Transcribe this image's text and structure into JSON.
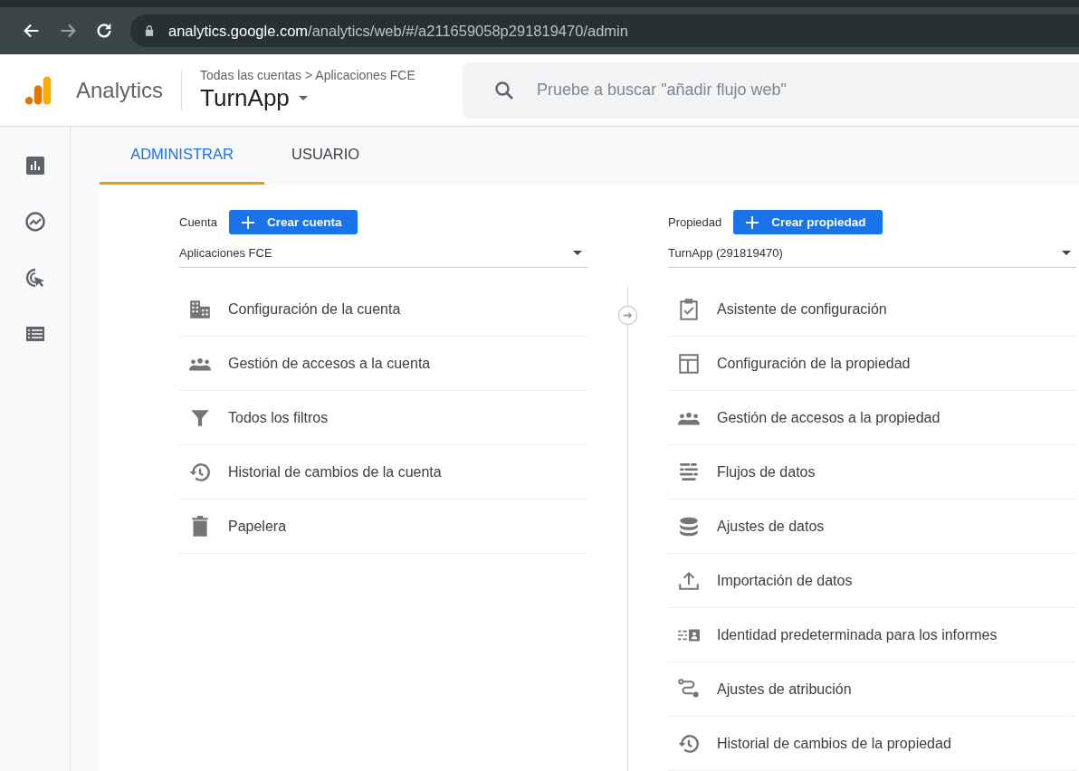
{
  "browser": {
    "url_host": "analytics.google.com",
    "url_path": "/analytics/web/#/a211659058p291819470/admin"
  },
  "header": {
    "product": "Analytics",
    "breadcrumb": "Todas las cuentas > Aplicaciones FCE",
    "property": "TurnApp",
    "search": {
      "placeholder": "Pruebe a buscar \"añadir flujo web\""
    }
  },
  "tabs": [
    {
      "label": "ADMINISTRAR",
      "selected": true
    },
    {
      "label": "USUARIO",
      "selected": false
    }
  ],
  "account": {
    "label": "Cuenta",
    "button": "Crear cuenta",
    "selector": "Aplicaciones FCE",
    "items": [
      {
        "label": "Configuración de la cuenta"
      },
      {
        "label": "Gestión de accesos a la cuenta"
      },
      {
        "label": "Todos los filtros"
      },
      {
        "label": "Historial de cambios de la cuenta"
      },
      {
        "label": "Papelera"
      }
    ]
  },
  "property": {
    "label": "Propiedad",
    "button": "Crear propiedad",
    "selector": "TurnApp (291819470)",
    "items": [
      {
        "label": "Asistente de configuración"
      },
      {
        "label": "Configuración de la propiedad"
      },
      {
        "label": "Gestión de accesos a la propiedad"
      },
      {
        "label": "Flujos de datos"
      },
      {
        "label": "Ajustes de datos"
      },
      {
        "label": "Importación de datos"
      },
      {
        "label": "Identidad predeterminada para los informes"
      },
      {
        "label": "Ajustes de atribución"
      },
      {
        "label": "Historial de cambios de la propiedad"
      }
    ]
  }
}
